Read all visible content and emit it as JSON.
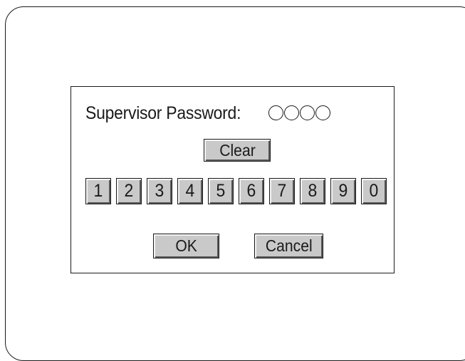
{
  "dialog": {
    "password_label": "Supervisor Password:",
    "password_slots": 4,
    "clear_label": "Clear",
    "keys": [
      "1",
      "2",
      "3",
      "4",
      "5",
      "6",
      "7",
      "8",
      "9",
      "0"
    ],
    "ok_label": "OK",
    "cancel_label": "Cancel"
  }
}
